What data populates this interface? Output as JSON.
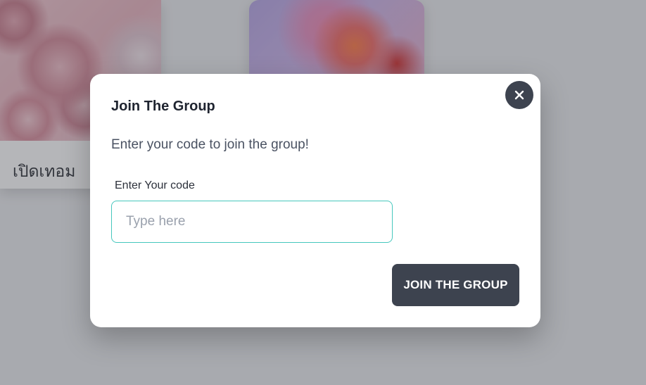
{
  "background": {
    "card_1": {
      "caption": "เปิดเทอม"
    }
  },
  "modal": {
    "title": "Join The Group",
    "subtitle": "Enter your code to join the group!",
    "field_label": "Enter Your code",
    "input": {
      "value": "",
      "placeholder": "Type here"
    },
    "submit_label": "JOIN THE GROUP",
    "close_icon": "close-icon"
  },
  "colors": {
    "primary_dark": "#3d434f",
    "input_border": "#46c7bd"
  }
}
